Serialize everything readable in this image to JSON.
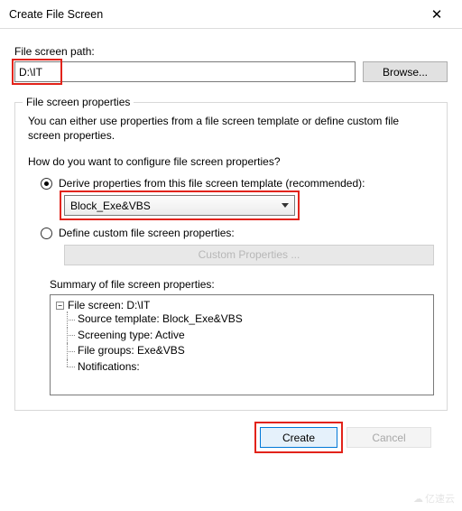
{
  "titlebar": {
    "title": "Create File Screen",
    "close": "✕"
  },
  "path_section": {
    "label": "File screen path:",
    "value": "D:\\IT",
    "browse": "Browse..."
  },
  "properties": {
    "legend": "File screen properties",
    "hint": "You can either use properties from a file screen template or define custom file screen properties.",
    "question": "How do you want to configure file screen properties?",
    "derive_label": "Derive properties from this file screen template (recommended):",
    "derive_checked": true,
    "template_selected": "Block_Exe&VBS",
    "define_label": "Define custom file screen properties:",
    "define_checked": false,
    "custom_button": "Custom Properties ...",
    "summary_label": "Summary of file screen properties:",
    "summary_root": "File screen: D:\\IT",
    "summary_items": [
      "Source template: Block_Exe&VBS",
      "Screening type: Active",
      "File groups: Exe&VBS",
      "Notifications:"
    ]
  },
  "footer": {
    "create": "Create",
    "cancel": "Cancel"
  },
  "watermark": "亿速云"
}
